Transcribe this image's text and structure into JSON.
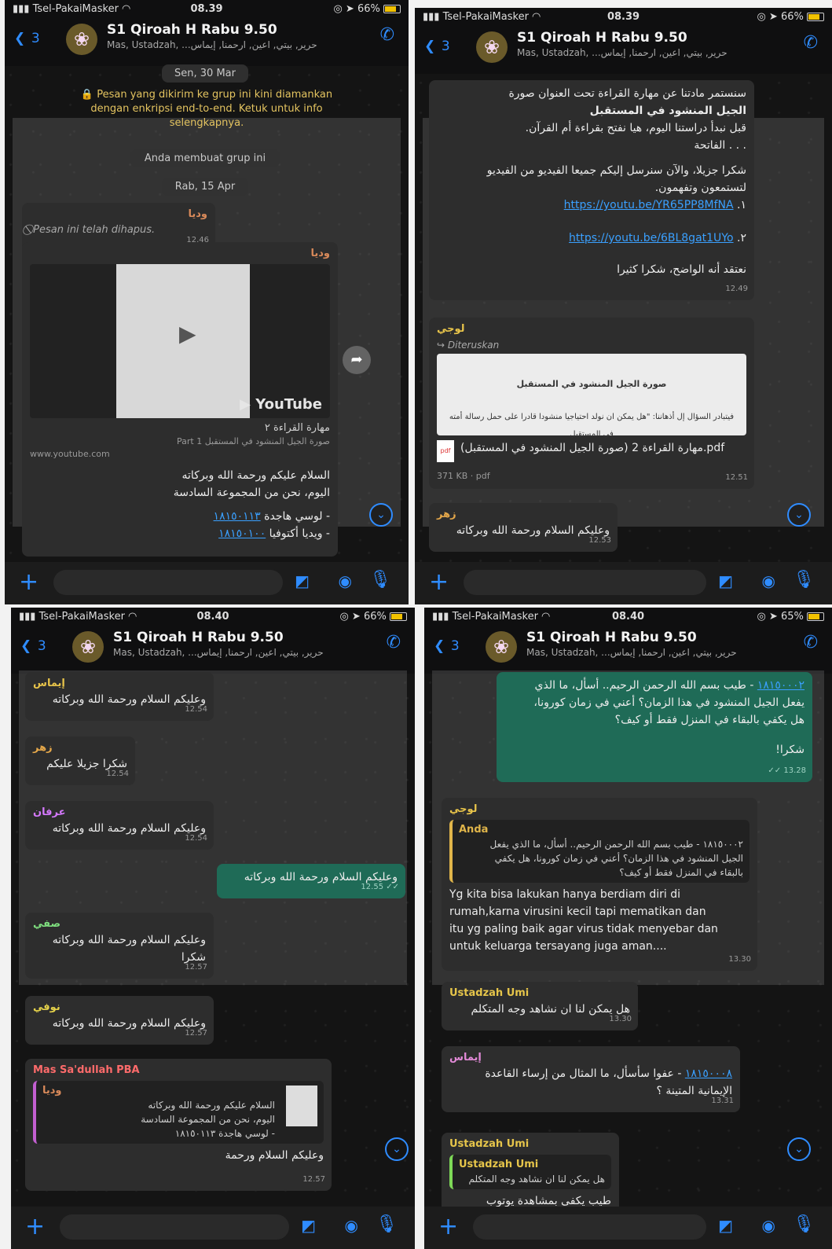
{
  "colors": {
    "accent": "#2f8cff",
    "outgoing": "#1f6b57",
    "incoming": "#2d2d2d",
    "notice": "#e4c460"
  },
  "common": {
    "carrier": "Tsel-PakaiMasker",
    "group_title": "S1 Qiroah H Rabu 9.50",
    "group_members": "Mas, Ustadzah, ...حرير, بيتي, اعين, ارحمنا, إيماس",
    "back_count": "3",
    "icons": [
      "back-chevron-icon",
      "add-call-icon",
      "plus-icon",
      "sticker-icon",
      "camera-icon",
      "microphone-icon",
      "scroll-down-icon",
      "share-icon",
      "pdf-icon",
      "forward-icon"
    ]
  },
  "panels": [
    {
      "time": "08.39",
      "battery": "66%",
      "date1": "Sen, 30 Mar",
      "encryption_notice": "🔒 Pesan yang dikirim ke grup ini kini diamankan dengan enkripsi end-to-end. Ketuk untuk info selengkapnya.",
      "created": "Anda membuat grup ini",
      "date2": "Rab, 15 Apr",
      "msg1": {
        "sender": "وديا",
        "text": "⃠ Pesan ini telah dihapus.",
        "time": "12.46"
      },
      "msg2": {
        "sender": "وديا",
        "yt_brand": "▶ YouTube",
        "yt_title": "مهارة القراءة ٢",
        "yt_sub": "صورة الجيل المنشود في المستقبل Part 1",
        "yt_domain": "www.youtube.com",
        "line1": "السلام عليكم ورحمة الله وبركاته",
        "line2": "اليوم، نحن من المجموعة السادسة",
        "line3a": "١٨١٥٠١١٣",
        "line3b": "- لوسي هاجدة",
        "line4a": "١٨١٥٠١٠٠",
        "line4b": "- ويديا أكتوفيا"
      }
    },
    {
      "time": "08.39",
      "battery": "66%",
      "msg1": {
        "line1": "سنستمر مادتنا عن مهارة القراءة   تحت العنوان صورة",
        "line2": "الجيل المنشود في المستقبل",
        "line3": "قبل نبدأ دراستنا اليوم، هيا نفتح بقراءة أم القرآن.",
        "line4": ". . . الفاتحة",
        "line5": "شكرا جزيلا، والآن سنرسل إليكم جميعا الفيديو من الفيديو",
        "line6": "لتستمعون وتفهمون.",
        "link1": "https://youtu.be/YR65PP8MfNA",
        "link1_num": "١.",
        "link2": "https://youtu.be/6BL8gat1UYo",
        "link2_num": "٢.",
        "line7": "نعتقد أنه الواضح، شكرا كثيرا",
        "time": "12.49"
      },
      "msg2": {
        "sender": "لوجي",
        "forwarded": "↪ Diteruskan",
        "doc_preview_title": "صورة الجيل المنشود في المستقبل",
        "doc_preview_text": "فيتبادر السؤال إل أذهاننا: \"هل يمكن ان نولد احتياجيا منشودا قادرا على حمل رسالة أمته في المستقبل",
        "file_name": "مهارة القراءة 2 (صورة الجيل المنشود في المستقبل).pdf",
        "pdf_label": "pdf",
        "meta": "371 KB · pdf",
        "time": "12.51"
      },
      "msg3": {
        "sender": "زهر",
        "text": "وعليكم السلام ورحمة الله وبركاته",
        "time": "12.53"
      }
    },
    {
      "time": "08.40",
      "battery": "66%",
      "msg1": {
        "sender": "إيماس",
        "text": "وعليكم السلام ورحمة الله وبركاته",
        "time": "12.54"
      },
      "msg2": {
        "sender": "زهر",
        "text": "شكرا جزيلا عليكم",
        "time": "12.54"
      },
      "msg3": {
        "sender": "عرفان",
        "text": "وعليكم السلام ورحمة الله وبركاته",
        "time": "12.54"
      },
      "msg4": {
        "text": "وعليكم السلام ورحمة الله وبركاته",
        "time": "12.55 ✓✓"
      },
      "msg5": {
        "sender": "صفي",
        "line1": "وعليكم السلام ورحمة الله وبركاته",
        "line2": "شكرا",
        "time": "12.57"
      },
      "msg6": {
        "sender": "نوفي",
        "text": "وعليكم السلام ورحمة الله وبركاته",
        "time": "12.57"
      },
      "msg7": {
        "sender": "Mas Sa'dullah PBA",
        "quote_name": "وديا",
        "quote_line1": "السلام عليكم ورحمة الله وبركاته",
        "quote_line2": "اليوم، نحن من المجموعة السادسة",
        "quote_line3": "- لوسي هاجدة ١٨١٥٠١١٣",
        "text": "وعليكم السلام ورحمة",
        "time": "12.57"
      }
    },
    {
      "time": "08.40",
      "battery": "65%",
      "msg1": {
        "line1a": "١٨١٥٠٠٠٢",
        "line1b": "- طيب بسم الله الرحمن الرحيم.. أسأل، ما الذي",
        "line2": "يفعل الجيل المنشود في هذا الزمان؟ أعني في زمان كورونا،",
        "line3": "هل يكفي بالبقاء في المنزل فقط أو كيف؟",
        "line4": "شكرا!",
        "time": "13.28 ✓✓"
      },
      "msg2": {
        "sender": "لوجي",
        "quote_name": "Anda",
        "quote_line1": "١٨١٥٠٠٠٢ - طيب بسم الله الرحمن الرحيم.. أسأل، ما الذي يفعل",
        "quote_line2": "الجيل المنشود في هذا الزمان؟ أعني في زمان كورونا، هل يكفي",
        "quote_line3": "بالبقاء في المنزل فقط أو كيف؟",
        "line1": "Yg kita bisa lakukan hanya berdiam diri di",
        "line2": "rumah,karna virusini kecil tapi mematikan dan",
        "line3": "itu yg paling baik agar virus tidak menyebar dan",
        "line4": "untuk keluarga tersayang juga aman....",
        "time": "13.30"
      },
      "msg3": {
        "sender": "Ustadzah Umi",
        "text": "هل يمكن لنا ان نشاهد وجه المتكلم",
        "time": "13.30"
      },
      "msg4": {
        "sender": "إيماس",
        "line1a": "١٨١٥٠٠٠٨",
        "line1b": "- عفوا سأسأل، ما المثال من إرساء القاعدة",
        "line2": "الإيمانية المتينة ؟",
        "time": "13.31"
      },
      "msg5": {
        "sender": "Ustadzah Umi",
        "quote_name": "Ustadzah Umi",
        "quote_text": "هل يمكن لنا ان نشاهد وجه المتكلم",
        "text": "طيب يكفى بمشاهدة يوتوب"
      }
    }
  ]
}
